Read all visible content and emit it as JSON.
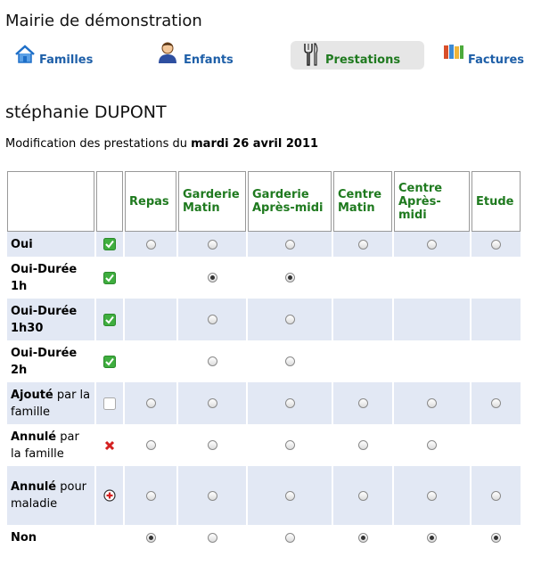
{
  "header": {
    "org_title": "Mairie de démonstration"
  },
  "nav": [
    {
      "label": "Familles",
      "icon": "house-icon"
    },
    {
      "label": "Enfants",
      "icon": "child-icon"
    },
    {
      "label": "Prestations",
      "icon": "cutlery-icon",
      "active": true
    },
    {
      "label": "Factures",
      "icon": "binders-icon"
    }
  ],
  "person": {
    "name": "stéphanie DUPONT"
  },
  "subtitle": {
    "prefix": "Modification des prestations du",
    "date": "mardi 26 avril 2011"
  },
  "table": {
    "columns": [
      "Repas",
      "Garderie Matin",
      "Garderie Après-midi",
      "Centre Matin",
      "Centre Après-midi",
      "Etude"
    ],
    "rows": [
      {
        "bold": "Oui",
        "rest": "",
        "status": "check",
        "radios": [
          "off",
          "off",
          "off",
          "off",
          "off",
          "off"
        ]
      },
      {
        "bold": "Oui-Durée 1h",
        "rest": "",
        "status": "check",
        "radios": [
          "",
          "on",
          "on",
          "",
          "",
          ""
        ]
      },
      {
        "bold": "Oui-Durée 1h30",
        "rest": "",
        "status": "check",
        "radios": [
          "",
          "off",
          "off",
          "",
          "",
          ""
        ]
      },
      {
        "bold": "Oui-Durée 2h",
        "rest": "",
        "status": "check",
        "radios": [
          "",
          "off",
          "off",
          "",
          "",
          ""
        ]
      },
      {
        "bold": "Ajouté",
        "rest": " par la famille",
        "status": "empty",
        "radios": [
          "off",
          "off",
          "off",
          "off",
          "off",
          "off"
        ]
      },
      {
        "bold": "Annulé",
        "rest": " par la famille",
        "status": "cross",
        "radios": [
          "off",
          "off",
          "off",
          "off",
          "off",
          ""
        ]
      },
      {
        "bold": "Annulé",
        "rest": " pour maladie",
        "status": "medical",
        "radios": [
          "off",
          "off",
          "off",
          "off",
          "off",
          "off"
        ]
      },
      {
        "bold": "Non",
        "rest": "",
        "status": "none",
        "radios": [
          "on",
          "off",
          "off",
          "on",
          "on",
          "on"
        ]
      }
    ]
  },
  "colors": {
    "link_blue": "#1e5fa8",
    "header_green": "#1f7a1f",
    "row_blue": "#e2e8f4"
  }
}
